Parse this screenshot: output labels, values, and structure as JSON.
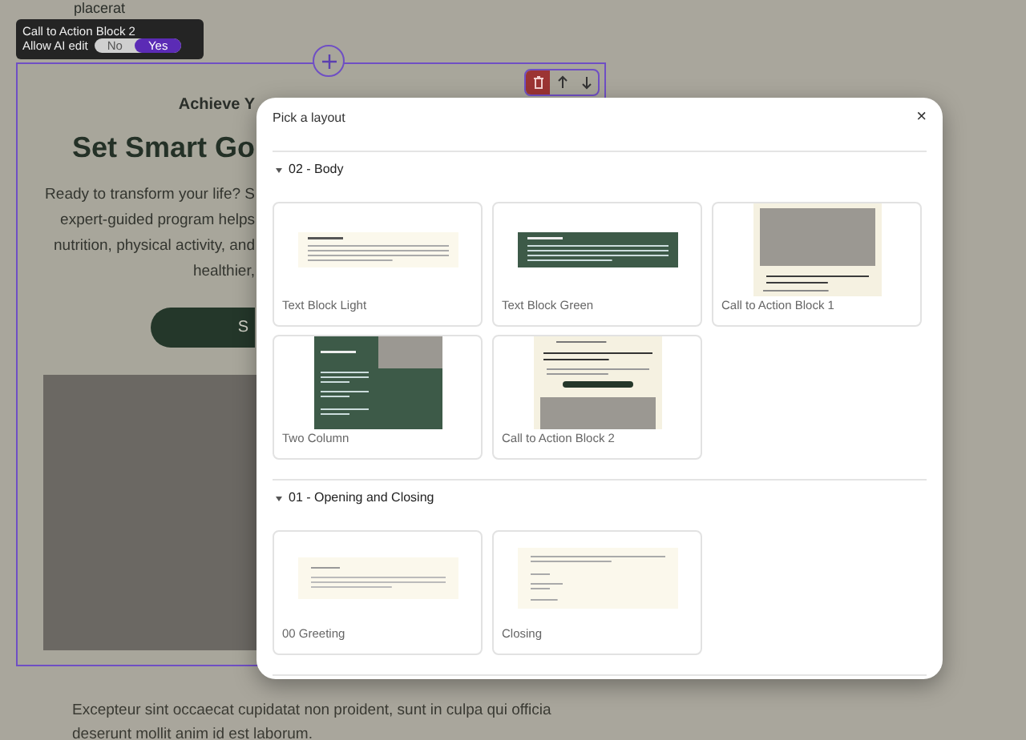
{
  "editor_toolbar": {
    "block_name": "Call to Action Block 2",
    "ai_edit_label": "Allow AI edit",
    "options": [
      {
        "label": "No",
        "selected": false
      },
      {
        "label": "Yes",
        "selected": true
      }
    ]
  },
  "page": {
    "top_text": "placerat",
    "block": {
      "eyebrow": "Achieve Y",
      "headline": "Set Smart Go",
      "paragraph_lines": [
        "Ready to transform your life? S",
        "expert-guided program helps",
        "nutrition, physical activity, and",
        "healthier,"
      ],
      "button": "S"
    },
    "footer_lines": [
      "Excepteur sint occaecat cupidatat non proident, sunt in culpa qui officia",
      "deserunt mollit anim id est laborum."
    ]
  },
  "modal": {
    "title": "Pick a layout",
    "close": "×",
    "sections": [
      {
        "title": "02 - Body",
        "expanded": true,
        "layouts": [
          {
            "name": "Text Block Light",
            "kind": "text-light"
          },
          {
            "name": "Text Block Green",
            "kind": "text-green"
          },
          {
            "name": "Call to Action Block 1",
            "kind": "cta1"
          },
          {
            "name": "Two Column",
            "kind": "two-column"
          },
          {
            "name": "Call to Action Block 2",
            "kind": "cta2"
          }
        ]
      },
      {
        "title": "01 - Opening and Closing",
        "expanded": true,
        "layouts": [
          {
            "name": "00 Greeting",
            "kind": "greeting"
          },
          {
            "name": "Closing",
            "kind": "closing"
          }
        ]
      }
    ]
  }
}
